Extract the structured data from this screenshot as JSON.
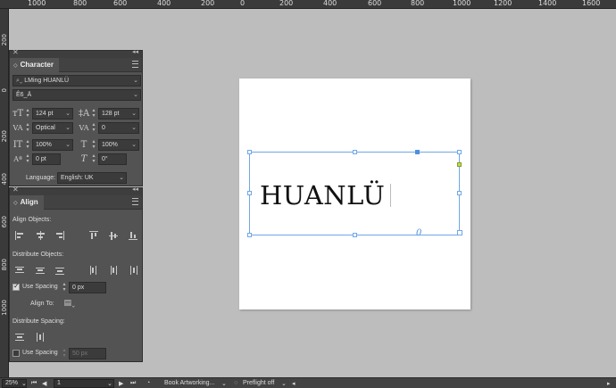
{
  "ruler": {
    "top_labels": [
      "1000",
      "800",
      "600",
      "400",
      "200",
      "0",
      "200",
      "400",
      "600",
      "800",
      "1000",
      "1200",
      "1400",
      "1600"
    ],
    "left_labels": [
      "200",
      "0",
      "200",
      "400",
      "600",
      "800",
      "1000"
    ]
  },
  "character_panel": {
    "title": "Character",
    "font_family": "LMing HUANLÜ",
    "font_style": "Ê6_Ä",
    "font_size": "124 pt",
    "leading": "128 pt",
    "kerning": "Optical",
    "tracking": "0",
    "vertical_scale": "100%",
    "horizontal_scale": "100%",
    "baseline_shift": "0 pt",
    "skew": "0°",
    "language_label": "Language:",
    "language": "English: UK"
  },
  "align_panel": {
    "title": "Align",
    "align_objects_label": "Align Objects:",
    "distribute_objects_label": "Distribute Objects:",
    "use_spacing_label": "Use Spacing",
    "use_spacing_value": "0 px",
    "align_to_label": "Align To:",
    "distribute_spacing_label": "Distribute Spacing:",
    "use_spacing2_label": "Use Spacing",
    "use_spacing2_value": "50 px"
  },
  "document": {
    "text": "HUANLÜ"
  },
  "statusbar": {
    "zoom": "25%",
    "page_number": "1",
    "profile": "Book Artworking...",
    "preflight": "Preflight off"
  },
  "colors": {
    "panel_bg": "#535353",
    "canvas_bg": "#bdbdbd",
    "selection": "#6fa7e8"
  }
}
